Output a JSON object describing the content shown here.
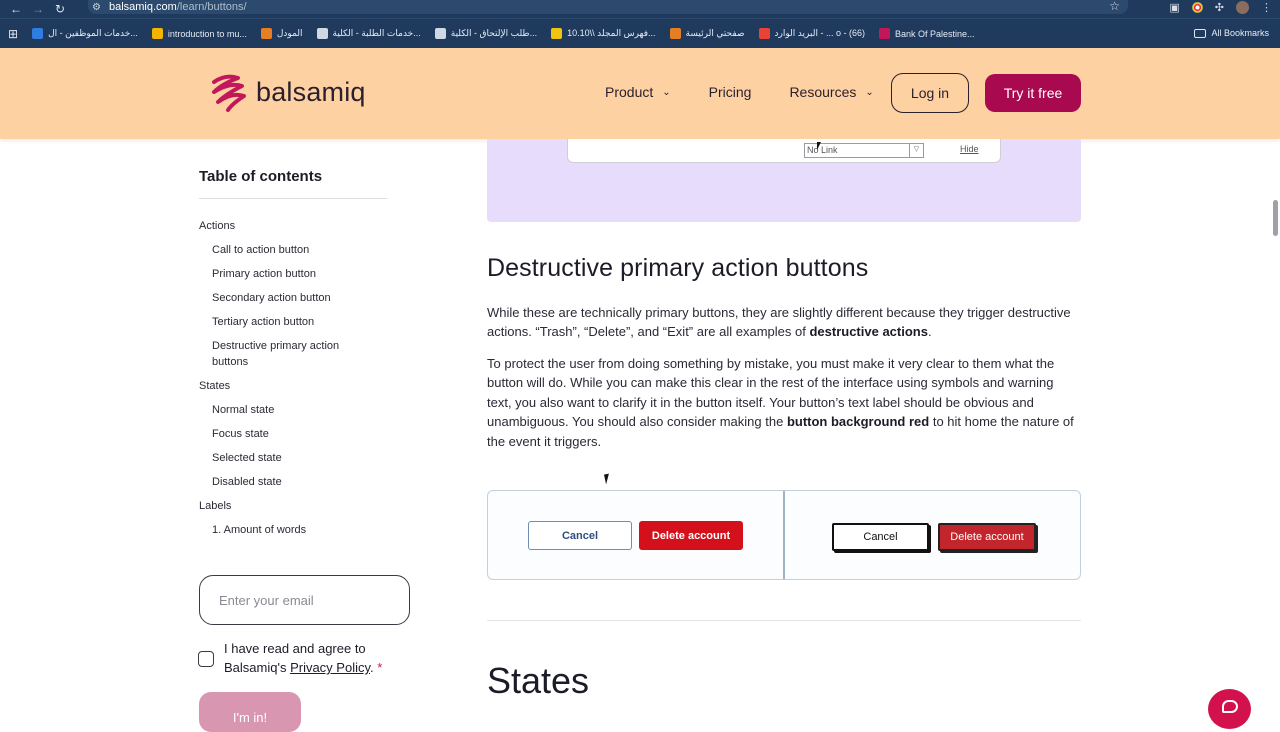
{
  "browser": {
    "url_domain": "balsamiq.com",
    "url_path": "/learn/buttons/",
    "bookmarks": [
      {
        "label": "خدمات الموظفين - ال...",
        "color": "#2f7de1"
      },
      {
        "label": "introduction to mu...",
        "color": "#f4b400"
      },
      {
        "label": "المودل",
        "color": "#e67e22"
      },
      {
        "label": "خدمات الطلبة - الكلية...",
        "color": "#cfd8e3"
      },
      {
        "label": "طلب الإلتحاق - الكلية...",
        "color": "#cfd8e3"
      },
      {
        "label": "فهرس المجلد \\\\10.10...",
        "color": "#f1c40f"
      },
      {
        "label": "صفحتي الرئيسة",
        "color": "#e67e22"
      },
      {
        "label": "البريد الوارد - ... o - (66)",
        "color": "#ea4335"
      },
      {
        "label": "Bank Of Palestine...",
        "color": "#c2185b"
      }
    ],
    "all_bookmarks_label": "All Bookmarks"
  },
  "header": {
    "logo_text": "balsamiq",
    "nav": {
      "product": "Product",
      "pricing": "Pricing",
      "resources": "Resources"
    },
    "login_label": "Log in",
    "try_label": "Try it free"
  },
  "sidebar": {
    "toc_title": "Table of contents",
    "items": [
      {
        "label": "Actions",
        "sub": false
      },
      {
        "label": "Call to action button",
        "sub": true
      },
      {
        "label": "Primary action button",
        "sub": true
      },
      {
        "label": "Secondary action button",
        "sub": true
      },
      {
        "label": "Tertiary action button",
        "sub": true
      },
      {
        "label": "Destructive primary action buttons",
        "sub": true
      },
      {
        "label": "States",
        "sub": false
      },
      {
        "label": "Normal state",
        "sub": true
      },
      {
        "label": "Focus state",
        "sub": true
      },
      {
        "label": "Selected state",
        "sub": true
      },
      {
        "label": "Disabled state",
        "sub": true
      },
      {
        "label": "Labels",
        "sub": false
      },
      {
        "label": "1. Amount of words",
        "sub": true
      }
    ],
    "email_placeholder": "Enter your email",
    "agree_prefix": "I have read and agree to Balsamiq's ",
    "privacy_link": "Privacy Policy",
    "agree_suffix": ".",
    "required_mark": " *",
    "submit_label": "I'm in!"
  },
  "main": {
    "top_demo": {
      "select_value": "No Link",
      "hide_link": "Hide"
    },
    "section_title": "Destructive primary action buttons",
    "p1_text": "While these are technically primary buttons, they are slightly different because they trigger destructive actions. “Trash”, “Delete”, and “Exit” are all examples of ",
    "p1_bold": "destructive actions",
    "p1_end": ".",
    "p2_text": "To protect the user from doing something by mistake, you must make it very clear to them what the button will do. While you can make this clear in the rest of the interface using symbols and warning text, you also want to clarify it in the button itself. Your button’s text label should be obvious and unambiguous. You should also consider making the ",
    "p2_bold": "button background red",
    "p2_end": " to hit home the nature of the event it triggers.",
    "demo": {
      "cancel_label": "Cancel",
      "delete_label": "Delete account"
    },
    "states_title": "States"
  },
  "colors": {
    "header_bg": "#fdd1a1",
    "brand": "#a8094f",
    "danger": "#d4101a",
    "demo_bg": "#e7dcfb"
  }
}
